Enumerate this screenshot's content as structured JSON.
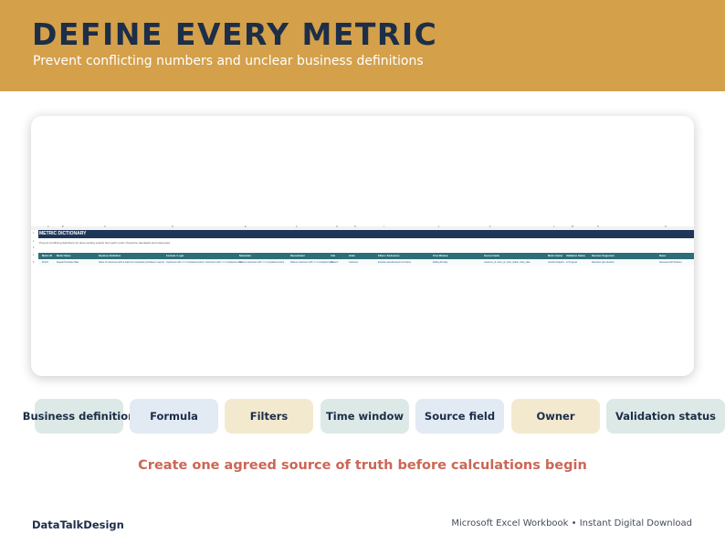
{
  "header": {
    "title": "DEFINE EVERY METRIC",
    "subtitle": "Prevent conflicting numbers and unclear business definitions"
  },
  "sheet": {
    "column_letters": [
      "A",
      "B",
      "C",
      "D",
      "E",
      "F",
      "G",
      "H",
      "I",
      "J",
      "K",
      "L",
      "M",
      "N",
      "O"
    ],
    "row_numbers": [
      "1",
      "2",
      "3",
      "4",
      "5"
    ],
    "title": "METRIC DICTIONARY",
    "subtitle": "Prevent conflicting definitions by documenting exactly how each metric should be calculated and interpreted.",
    "columns": [
      "Metric ID",
      "Metric Name",
      "Business Definition",
      "Formula / Logic",
      "Numerator",
      "Denominator",
      "Unit",
      "Grain",
      "Filters / Exclusions",
      "Time Window",
      "Source Fields",
      "Metric Owner",
      "Validation Status",
      "Decision Supported",
      "Notes"
    ],
    "rows": [
      [
        "M-001",
        "Repeat Purchase Rate",
        "Share of customers with at least two completed purchases in period",
        "Customers with >= 2 completed orders / Customers with >= 1 completed order",
        "Distinct customers with >= 2 completed orders",
        "Distinct customers with >= 1 completed order",
        "Percent",
        "Customer",
        "Exclude cancelled and test orders",
        "Rolling 90 days",
        "customer_id, order_id, order_status, order_date",
        "Growth Analytics",
        "In Progress",
        "Retention plan decision",
        "Reviewed with Finance"
      ]
    ]
  },
  "chips": [
    {
      "label": "Business definition",
      "bg": "#DCE9E6"
    },
    {
      "label": "Formula",
      "bg": "#E2EAF3"
    },
    {
      "label": "Filters",
      "bg": "#F3E9CF"
    },
    {
      "label": "Time window",
      "bg": "#DCE9E6"
    },
    {
      "label": "Source field",
      "bg": "#E2EAF3"
    },
    {
      "label": "Owner",
      "bg": "#F3E9CF"
    },
    {
      "label": "Validation status",
      "bg": "#DCE9E6"
    }
  ],
  "cta": "Create one agreed source of truth before calculations begin",
  "footer": {
    "brand": "DataTalkDesign",
    "info": "Microsoft Excel Workbook • Instant Digital Download"
  },
  "colors": {
    "header_bg": "#D4A04A",
    "title": "#1C2E48",
    "cta": "#CC6655",
    "sheet_title_bar": "#1D3557",
    "sheet_header": "#2E6E78"
  }
}
